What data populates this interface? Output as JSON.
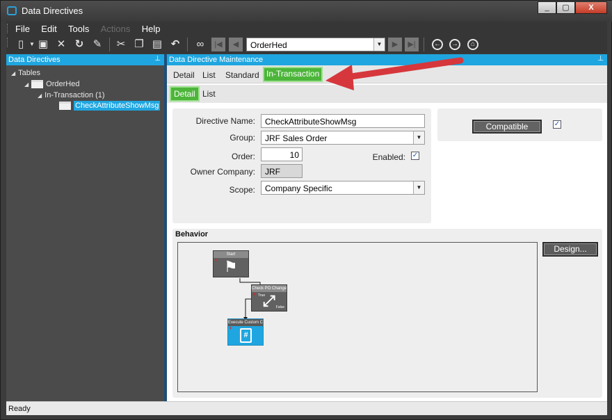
{
  "window": {
    "title": "Data Directives",
    "min_glyph": "_",
    "max_glyph": "▢",
    "close_glyph": "X"
  },
  "menu": {
    "items": [
      "File",
      "Edit",
      "Tools",
      "Actions",
      "Help"
    ],
    "disabled_item": "Actions"
  },
  "toolbar": {
    "icons": [
      "new-icon",
      "save-icon",
      "delete-icon",
      "refresh-icon",
      "clear-icon",
      "cut-icon",
      "copy-icon",
      "paste-icon",
      "undo-icon",
      "binoculars-icon",
      "first-icon",
      "prev-icon",
      "next-icon",
      "last-icon",
      "back-icon",
      "forward-icon",
      "home-icon"
    ],
    "record_value": "OrderHed"
  },
  "left_panel": {
    "header": "Data Directives",
    "tree": {
      "root": "Tables",
      "table": "OrderHed",
      "group": "In-Transaction (1)",
      "selected": "CheckAttributeShowMsg"
    }
  },
  "right_panel": {
    "header": "Data Directive Maintenance",
    "tabs": [
      "Detail",
      "List",
      "Standard",
      "In-Transaction"
    ],
    "active_tab": "In-Transaction",
    "sub_tabs": [
      "Detail",
      "List"
    ],
    "active_sub_tab": "Detail"
  },
  "form": {
    "directive_name_label": "Directive Name:",
    "directive_name_value": "CheckAttributeShowMsg",
    "group_label": "Group:",
    "group_value": "JRF Sales Order",
    "order_label": "Order:",
    "order_value": "10",
    "enabled_label": "Enabled:",
    "enabled_checked": true,
    "owner_company_label": "Owner Company:",
    "owner_company_value": "JRF",
    "scope_label": "Scope:",
    "scope_value": "Company Specific",
    "compatible_label": "Compatible",
    "compatible_checked": true
  },
  "behavior": {
    "title": "Behavior",
    "design_button": "Design...",
    "nodes": [
      {
        "label": "Start",
        "glyph": "⚑"
      },
      {
        "label": "Check PO Change",
        "glyph": "⤢",
        "true_label": "True",
        "false_label": "False"
      },
      {
        "label": "Execute Custom Code",
        "glyph": "#"
      }
    ]
  },
  "status": {
    "text": "Ready"
  },
  "colors": {
    "accent": "#1fa6e0",
    "active_tab": "#4cb53a",
    "annotation_arrow": "#e8383d"
  }
}
